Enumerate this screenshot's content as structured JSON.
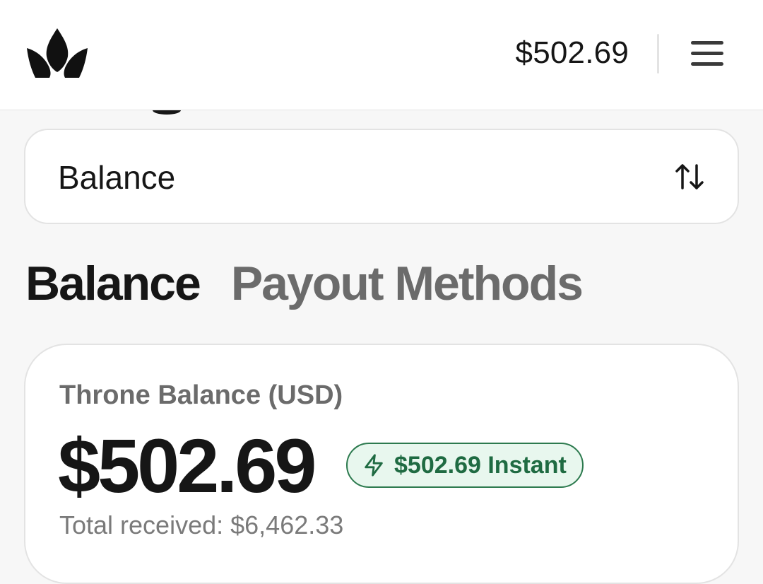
{
  "header": {
    "logo_icon": "crown-icon",
    "balance": "$502.69",
    "menu_icon": "hamburger-menu-icon"
  },
  "select": {
    "value": "Balance",
    "icon": "sort-arrows-icon"
  },
  "tabs": [
    {
      "label": "Balance",
      "active": true
    },
    {
      "label": "Payout Methods",
      "active": false
    }
  ],
  "balance_card": {
    "title": "Throne Balance (USD)",
    "amount": "$502.69",
    "instant_badge": {
      "icon": "lightning-icon",
      "label": "$502.69 Instant"
    },
    "total_received": "Total received: $6,462.33"
  },
  "colors": {
    "text": "#161616",
    "muted": "#6b6b6b",
    "badge_bg": "#e8f7ee",
    "badge_border": "#2c7a4e",
    "badge_text": "#1f6b42"
  }
}
